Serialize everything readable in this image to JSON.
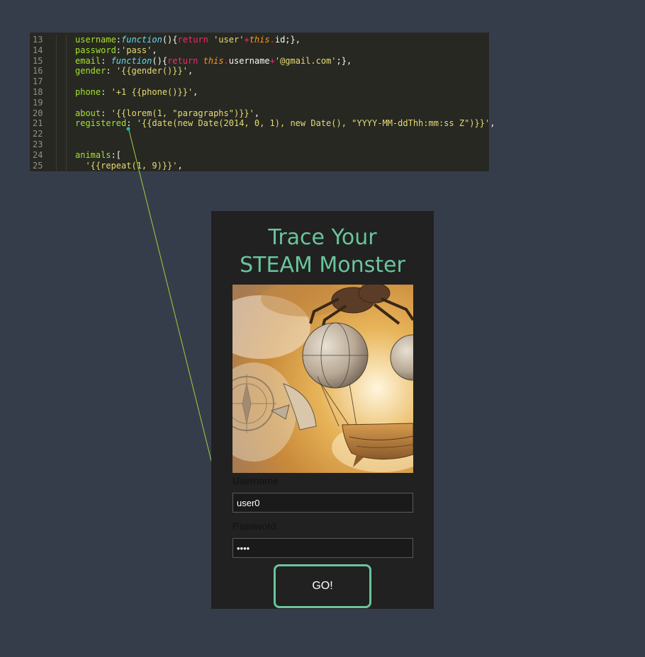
{
  "code_editor": {
    "lines": [
      {
        "number": "13",
        "tokens": [
          {
            "t": "username",
            "c": "tk-key"
          },
          {
            "t": ":",
            "c": "tk-plain"
          },
          {
            "t": "function",
            "c": "tk-fn"
          },
          {
            "t": "(){",
            "c": "tk-plain"
          },
          {
            "t": "return",
            "c": "tk-kw"
          },
          {
            "t": " ",
            "c": "tk-plain"
          },
          {
            "t": "'user'",
            "c": "tk-str"
          },
          {
            "t": "+",
            "c": "tk-op"
          },
          {
            "t": "this",
            "c": "tk-this"
          },
          {
            "t": ".",
            "c": "tk-op"
          },
          {
            "t": "id;},",
            "c": "tk-plain"
          }
        ]
      },
      {
        "number": "14",
        "tokens": [
          {
            "t": "password",
            "c": "tk-key"
          },
          {
            "t": ":",
            "c": "tk-plain"
          },
          {
            "t": "'pass'",
            "c": "tk-str"
          },
          {
            "t": ",",
            "c": "tk-plain"
          }
        ]
      },
      {
        "number": "15",
        "tokens": [
          {
            "t": "email",
            "c": "tk-key"
          },
          {
            "t": ": ",
            "c": "tk-plain"
          },
          {
            "t": "function",
            "c": "tk-fn"
          },
          {
            "t": "(){",
            "c": "tk-plain"
          },
          {
            "t": "return",
            "c": "tk-kw"
          },
          {
            "t": " ",
            "c": "tk-plain"
          },
          {
            "t": "this",
            "c": "tk-this"
          },
          {
            "t": ".",
            "c": "tk-op"
          },
          {
            "t": "username",
            "c": "tk-plain"
          },
          {
            "t": "+",
            "c": "tk-op"
          },
          {
            "t": "'@gmail.com'",
            "c": "tk-str"
          },
          {
            "t": ";},",
            "c": "tk-plain"
          }
        ]
      },
      {
        "number": "16",
        "tokens": [
          {
            "t": "gender",
            "c": "tk-key"
          },
          {
            "t": ": ",
            "c": "tk-plain"
          },
          {
            "t": "'{{gender()}}'",
            "c": "tk-str"
          },
          {
            "t": ",",
            "c": "tk-plain"
          }
        ]
      },
      {
        "number": "17",
        "tokens": []
      },
      {
        "number": "18",
        "tokens": [
          {
            "t": "phone",
            "c": "tk-key"
          },
          {
            "t": ": ",
            "c": "tk-plain"
          },
          {
            "t": "'+1 {{phone()}}'",
            "c": "tk-str"
          },
          {
            "t": ",",
            "c": "tk-plain"
          }
        ]
      },
      {
        "number": "19",
        "tokens": []
      },
      {
        "number": "20",
        "tokens": [
          {
            "t": "about",
            "c": "tk-key"
          },
          {
            "t": ": ",
            "c": "tk-plain"
          },
          {
            "t": "'{{lorem(1, \"paragraphs\")}}'",
            "c": "tk-str"
          },
          {
            "t": ",",
            "c": "tk-plain"
          }
        ]
      },
      {
        "number": "21",
        "tokens": [
          {
            "t": "registered",
            "c": "tk-key"
          },
          {
            "t": ": ",
            "c": "tk-plain"
          },
          {
            "t": "'{{date(new Date(2014, 0, 1), new Date(), \"YYYY-MM-ddThh:mm:ss Z\")}}'",
            "c": "tk-str"
          },
          {
            "t": ",",
            "c": "tk-plain"
          }
        ]
      },
      {
        "number": "22",
        "tokens": []
      },
      {
        "number": "23",
        "tokens": []
      },
      {
        "number": "24",
        "tokens": [
          {
            "t": "animals",
            "c": "tk-key"
          },
          {
            "t": ":[",
            "c": "tk-plain"
          }
        ]
      },
      {
        "number": "25",
        "tokens": [
          {
            "t": "  ",
            "c": "tk-plain"
          },
          {
            "t": "'{{repeat(1, 9)}}'",
            "c": "tk-str"
          },
          {
            "t": ",",
            "c": "tk-plain"
          }
        ]
      }
    ]
  },
  "connector": {
    "color": "#9bd23a",
    "dot_color": "#2bb3b0"
  },
  "app": {
    "title_line1": "Trace Your",
    "title_line2": "STEAM Monster",
    "accent_color": "#6ac49c",
    "image_icon": "steampunk-airship-image",
    "username_label": "Username",
    "username_value": "user0",
    "password_label": "Password",
    "password_value": "pass",
    "go_label": "GO!"
  }
}
